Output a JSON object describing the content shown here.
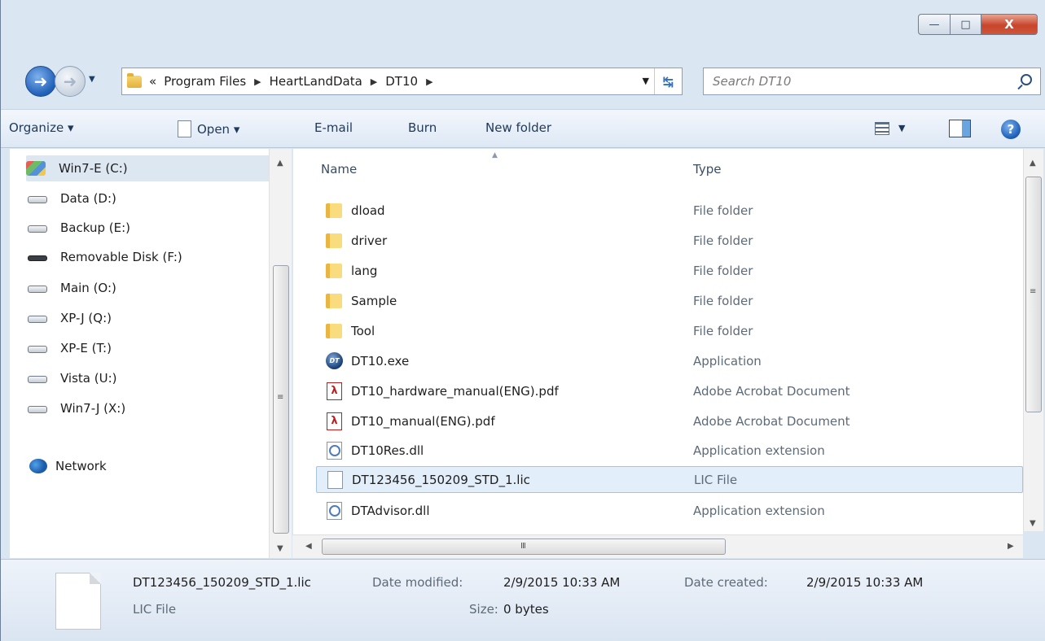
{
  "window": {
    "caption_buttons": {
      "minimize": "—",
      "maximize": "□",
      "close": "X"
    }
  },
  "address": {
    "overflow": "«",
    "crumbs": [
      "Program Files",
      "HeartLandData",
      "DT10"
    ],
    "separator": "▶",
    "dropdown": "▼",
    "refresh": "↹"
  },
  "search": {
    "placeholder": "Search DT10"
  },
  "toolbar": {
    "organize": "Organize ▾",
    "open": "Open ▾",
    "email": "E-mail",
    "burn": "Burn",
    "new_folder": "New folder",
    "views_dropdown": "▼",
    "help": "?"
  },
  "navigation": {
    "items": [
      {
        "label": "Win7-E (C:)",
        "icon": "windows-drive-icon",
        "selected": true
      },
      {
        "label": "Data (D:)",
        "icon": "hard-drive-icon"
      },
      {
        "label": "Backup (E:)",
        "icon": "hard-drive-icon"
      },
      {
        "label": "Removable Disk (F:)",
        "icon": "removable-disk-icon"
      },
      {
        "label": "Main (O:)",
        "icon": "hard-drive-icon"
      },
      {
        "label": "XP-J (Q:)",
        "icon": "hard-drive-icon"
      },
      {
        "label": "XP-E (T:)",
        "icon": "hard-drive-icon"
      },
      {
        "label": "Vista (U:)",
        "icon": "hard-drive-icon"
      },
      {
        "label": "Win7-J (X:)",
        "icon": "hard-drive-icon"
      }
    ],
    "network": "Network"
  },
  "files": {
    "columns": {
      "name": "Name",
      "type": "Type"
    },
    "rows": [
      {
        "name": "dload",
        "type": "File folder",
        "icon": "folder-icon"
      },
      {
        "name": "driver",
        "type": "File folder",
        "icon": "folder-icon"
      },
      {
        "name": "lang",
        "type": "File folder",
        "icon": "folder-icon"
      },
      {
        "name": "Sample",
        "type": "File folder",
        "icon": "folder-icon"
      },
      {
        "name": "Tool",
        "type": "File folder",
        "icon": "folder-icon"
      },
      {
        "name": "DT10.exe",
        "type": "Application",
        "icon": "exe-icon"
      },
      {
        "name": "DT10_hardware_manual(ENG).pdf",
        "type": "Adobe Acrobat Document",
        "icon": "pdf-icon"
      },
      {
        "name": "DT10_manual(ENG).pdf",
        "type": "Adobe Acrobat Document",
        "icon": "pdf-icon"
      },
      {
        "name": "DT10Res.dll",
        "type": "Application extension",
        "icon": "dll-icon"
      },
      {
        "name": "DT123456_150209_STD_1.lic",
        "type": "LIC File",
        "icon": "lic-file-icon",
        "selected": true
      },
      {
        "name": "DTAdvisor.dll",
        "type": "Application extension",
        "icon": "dll-icon"
      }
    ]
  },
  "details": {
    "file_name": "DT123456_150209_STD_1.lic",
    "file_type": "LIC File",
    "date_modified_label": "Date modified:",
    "date_modified": "2/9/2015 10:33 AM",
    "size_label": "Size:",
    "size": "0 bytes",
    "date_created_label": "Date created:",
    "date_created": "2/9/2015 10:33 AM"
  }
}
